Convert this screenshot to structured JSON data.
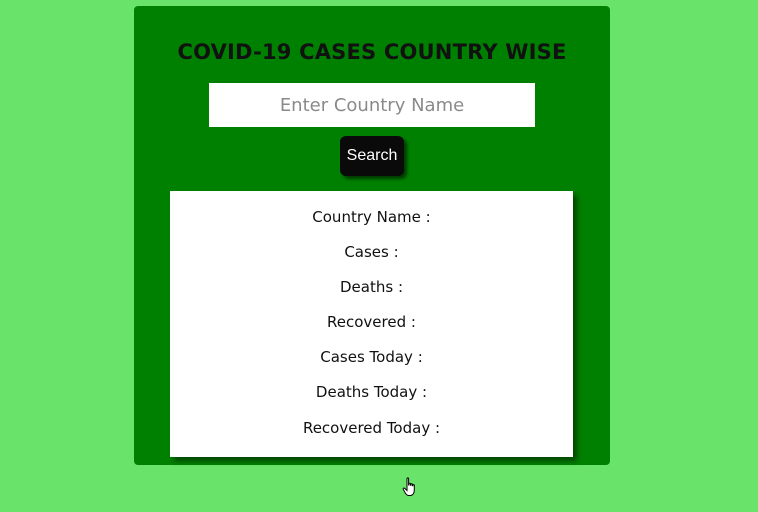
{
  "header": {
    "title": "COVID-19 CASES COUNTRY WISE"
  },
  "search": {
    "placeholder": "Enter Country Name",
    "value": "",
    "button_label": "Search"
  },
  "results": {
    "country_name_label": "Country Name :",
    "cases_label": "Cases :",
    "deaths_label": "Deaths :",
    "recovered_label": "Recovered :",
    "cases_today_label": "Cases Today :",
    "deaths_today_label": "Deaths Today :",
    "recovered_today_label": "Recovered Today :"
  },
  "colors": {
    "page_background": "#6ae36a",
    "card_background": "#008000",
    "button_background": "#0a0a0a"
  },
  "icons": {
    "cursor": "hand-pointer-icon"
  }
}
